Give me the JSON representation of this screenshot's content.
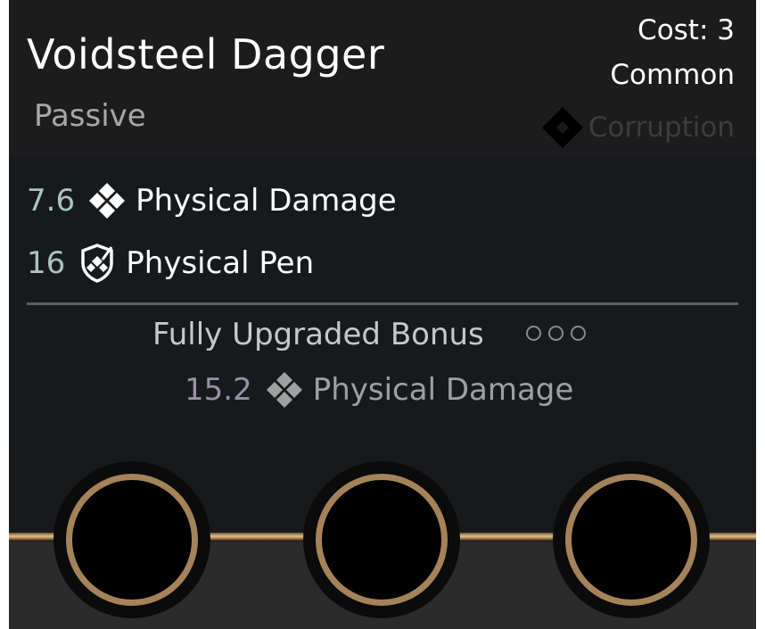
{
  "item": {
    "name": "Voidsteel Dagger",
    "type": "Passive",
    "cost_label": "Cost: 3",
    "rarity": "Common",
    "school": "Corruption",
    "school_icon": "corruption-diamond-icon"
  },
  "stats": [
    {
      "value": "7.6",
      "icon": "physical-damage-icon",
      "label": "Physical Damage"
    },
    {
      "value": "16",
      "icon": "physical-pen-icon",
      "label": "Physical Pen"
    }
  ],
  "upgrade": {
    "title": "Fully Upgraded Bonus",
    "upgrades_filled": 0,
    "upgrades_total": 3,
    "bonus": {
      "value": "15.2",
      "icon": "physical-damage-icon",
      "label": "Physical Damage"
    }
  },
  "sockets": {
    "count": 3,
    "filled": 0
  },
  "colors": {
    "accent_gold": "#a5835a",
    "stat_value": "#a9c3c1",
    "bonus_value": "#9a8fa6"
  }
}
